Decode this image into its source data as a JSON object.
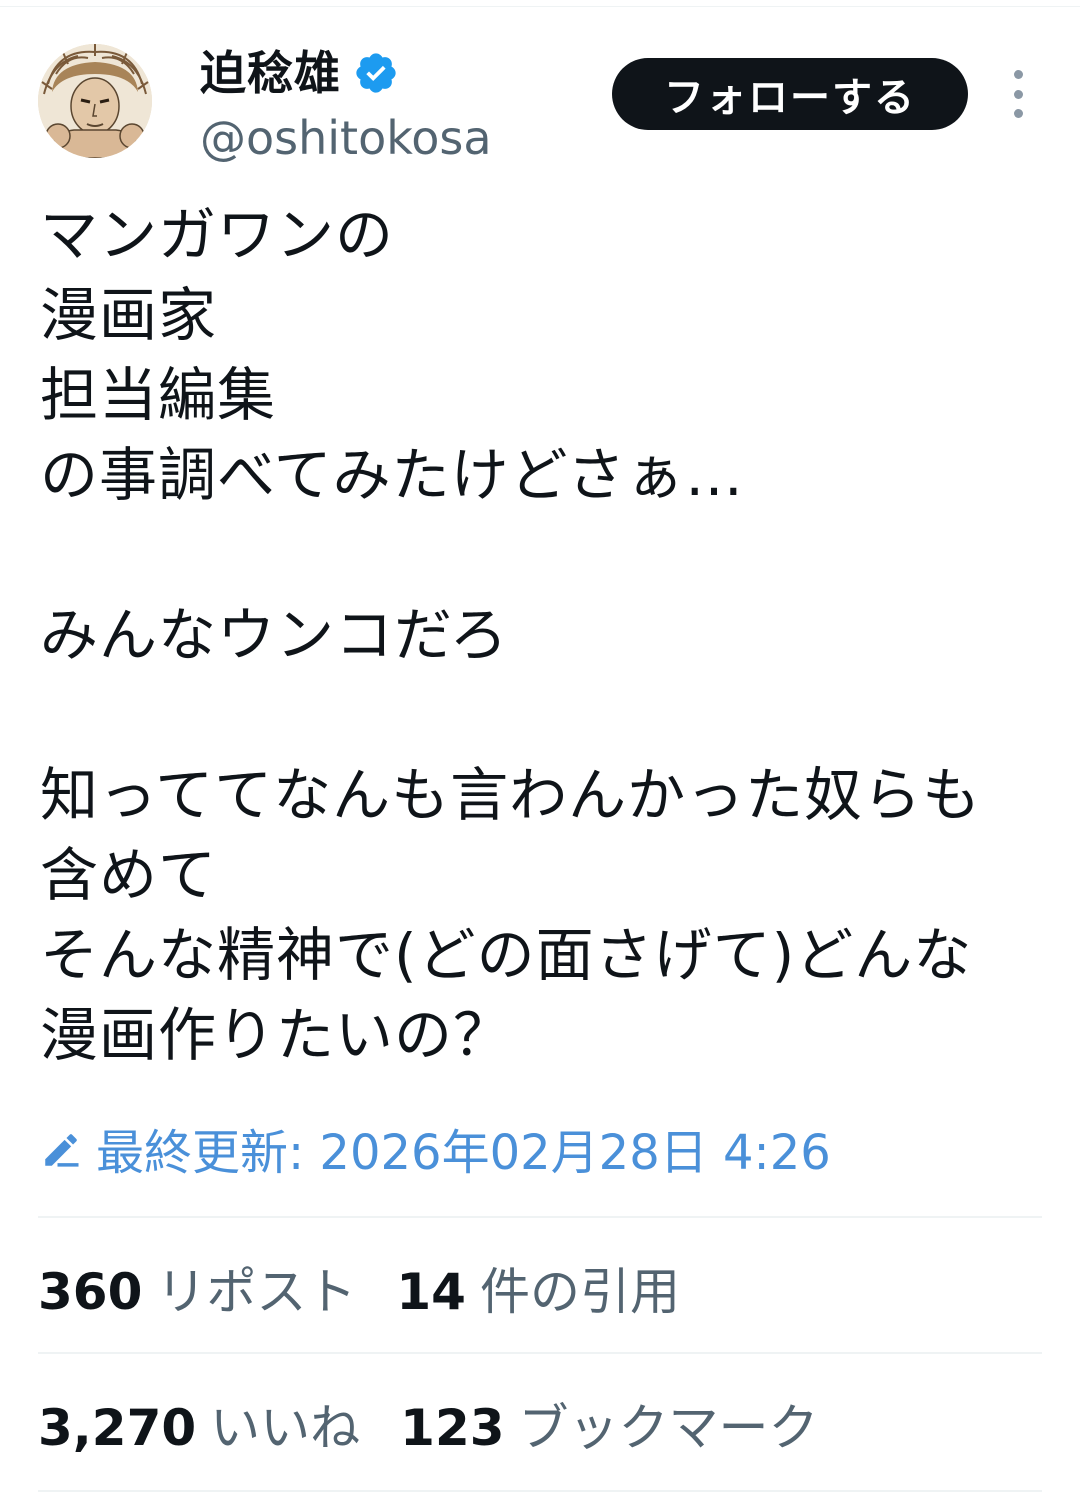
{
  "user": {
    "display_name": "迫稔雄",
    "handle": "@oshitokosa",
    "verified_color": "#1d9bf0"
  },
  "follow_button": {
    "label": "フォローする"
  },
  "tweet": {
    "lines": [
      "マンガワンの",
      "漫画家",
      "担当編集",
      "の事調べてみたけどさぁ…",
      "",
      "みんなウンコだろ",
      "",
      "知っててなんも言わんかった奴らも",
      "含めて",
      "そんな精神で(どの面さげて)どんな",
      "漫画作りたいの？"
    ]
  },
  "edited": {
    "text": "最終更新: 2026年02月28日 4:26",
    "color": "#4a90d9"
  },
  "stats": {
    "retweets": {
      "count": "360",
      "label": "リポスト"
    },
    "quotes": {
      "count": "14",
      "label": "件の引用"
    },
    "likes": {
      "count": "3,270",
      "label": "いいね"
    },
    "bookmarks": {
      "count": "123",
      "label": "ブックマーク"
    }
  },
  "icons": {
    "avatar": "manga-character-avatar",
    "verified": "verified-badge-icon",
    "more": "more-options-icon",
    "edit": "pencil-icon"
  }
}
